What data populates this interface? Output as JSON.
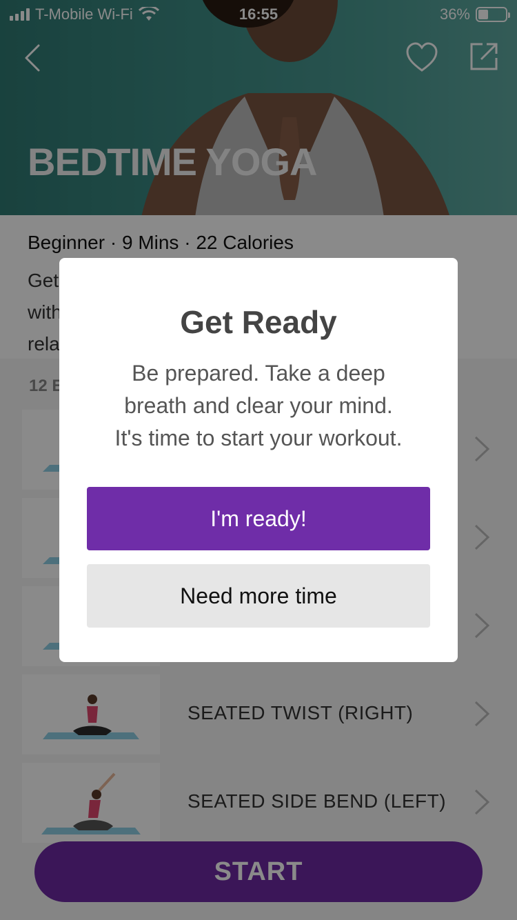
{
  "status_bar": {
    "carrier": "T-Mobile Wi-Fi",
    "time": "16:55",
    "battery": "36%",
    "battery_level": 0.36
  },
  "hero": {
    "title": "BEDTIME YOGA"
  },
  "info": {
    "meta": "Beginner · 9 Mins · 22 Calories",
    "desc_line1": "Get",
    "desc_line2": "with",
    "desc_line3": "rela"
  },
  "exercises": {
    "section_label": "12 E",
    "items": [
      {
        "name": ""
      },
      {
        "name": ""
      },
      {
        "name": ""
      },
      {
        "name": "SEATED TWIST (RIGHT)"
      },
      {
        "name": "SEATED SIDE BEND (LEFT)"
      }
    ]
  },
  "start": {
    "label": "START"
  },
  "modal": {
    "title": "Get Ready",
    "body_line1": "Be prepared. Take a deep",
    "body_line2": "breath and clear your mind.",
    "body_line3": "It's time to start your workout.",
    "ready_label": "I'm ready!",
    "more_label": "Need more time"
  },
  "colors": {
    "accent": "#6f2da8",
    "hero_teal": "#3c8b84"
  },
  "icons": [
    "back-chevron-icon",
    "heart-icon",
    "share-icon",
    "chevron-right-icon",
    "wifi-icon",
    "signal-icon",
    "battery-icon"
  ]
}
